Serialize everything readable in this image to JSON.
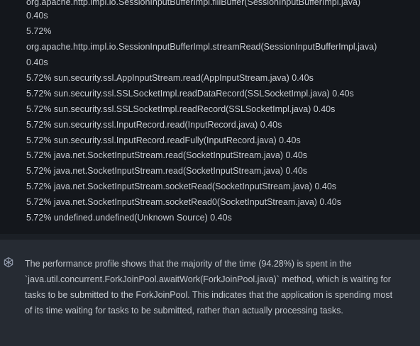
{
  "profile_output": {
    "lines": [
      "org.apache.http.impl.io.SessionInputBufferImpl.fillBuffer(SessionInputBufferImpl.java)",
      "0.40s",
      "5.72%",
      "org.apache.http.impl.io.SessionInputBufferImpl.streamRead(SessionInputBufferImpl.java)",
      "0.40s",
      "5.72% sun.security.ssl.AppInputStream.read(AppInputStream.java) 0.40s",
      "5.72% sun.security.ssl.SSLSocketImpl.readDataRecord(SSLSocketImpl.java) 0.40s",
      "5.72% sun.security.ssl.SSLSocketImpl.readRecord(SSLSocketImpl.java) 0.40s",
      "5.72% sun.security.ssl.InputRecord.read(InputRecord.java) 0.40s",
      "5.72% sun.security.ssl.InputRecord.readFully(InputRecord.java) 0.40s",
      "5.72% java.net.SocketInputStream.read(SocketInputStream.java) 0.40s",
      "5.72% java.net.SocketInputStream.read(SocketInputStream.java) 0.40s",
      "5.72% java.net.SocketInputStream.socketRead(SocketInputStream.java) 0.40s",
      "5.72% java.net.SocketInputStream.socketRead0(SocketInputStream.java) 0.40s",
      "5.72% undefined.undefined(Unknown Source) 0.40s"
    ]
  },
  "assistant_message": {
    "icon": "openai-logo-icon",
    "text": "The performance profile shows that the majority of the time (94.28%) is spent in the `java.util.concurrent.ForkJoinPool.awaitWork(ForkJoinPool.java)` method, which is waiting for tasks to be submitted to the ForkJoinPool. This indicates that the application is spending most of its time waiting for tasks to be submitted, rather than actually processing tasks."
  },
  "colors": {
    "code_background": "#14171c",
    "message_background": "#262b33",
    "text": "#c8ccd2"
  }
}
